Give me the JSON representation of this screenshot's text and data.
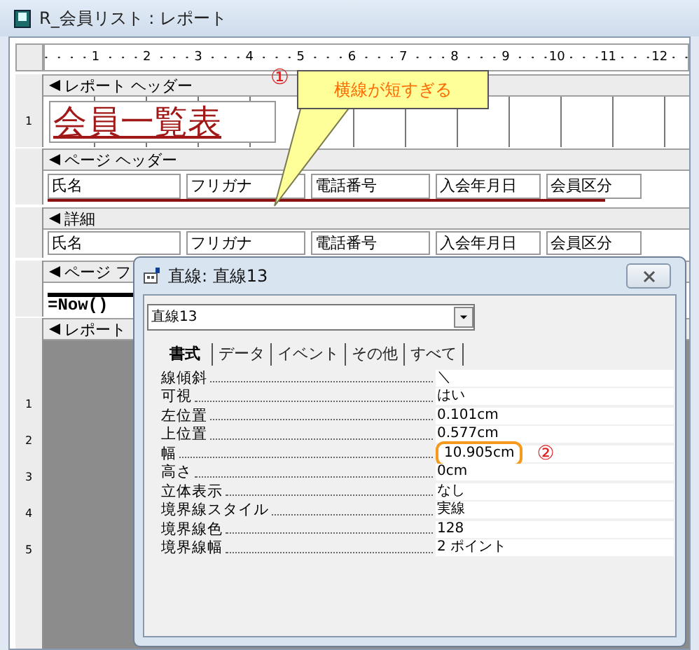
{
  "window": {
    "title": "R_会員リスト : レポート"
  },
  "ruler": {
    "labels": [
      "1",
      "2",
      "3",
      "4",
      "5",
      "6",
      "7",
      "8",
      "9",
      "10",
      "11",
      "12"
    ]
  },
  "left_ruler": {
    "header_label": "1",
    "bottom_labels": [
      "1",
      "2",
      "3",
      "4",
      "5"
    ]
  },
  "report_header": {
    "bar": "レポート ヘッダー",
    "title": "会員一覧表"
  },
  "page_header": {
    "bar": "ページ ヘッダー",
    "labels": [
      "氏名",
      "フリガナ",
      "電話番号",
      "入会年月日",
      "会員区分"
    ]
  },
  "detail": {
    "bar": "詳細",
    "fields": [
      "氏名",
      "フリガナ",
      "電話番号",
      "入会年月日",
      "会員区分"
    ]
  },
  "page_footer": {
    "bar": "ページ フ",
    "expression": "=Now()"
  },
  "report_footer": {
    "bar": "レポート"
  },
  "callout": {
    "marker": "①",
    "text": "横線が短すぎる"
  },
  "dialog": {
    "title": "直線: 直線13",
    "object": "直線13",
    "tabs": [
      {
        "label": "書式",
        "selected": true
      },
      {
        "label": "データ",
        "selected": false
      },
      {
        "label": "イベント",
        "selected": false
      },
      {
        "label": "その他",
        "selected": false
      },
      {
        "label": "すべて",
        "selected": false
      }
    ],
    "properties": [
      {
        "label": "線傾斜",
        "value": "＼",
        "highlighted": false
      },
      {
        "label": "可視",
        "value": "はい",
        "highlighted": false
      },
      {
        "label": "左位置",
        "value": "0.101cm",
        "highlighted": false
      },
      {
        "label": "上位置",
        "value": "0.577cm",
        "highlighted": false
      },
      {
        "label": "幅",
        "value": "10.905cm",
        "highlighted": true
      },
      {
        "label": "高さ",
        "value": "0cm",
        "highlighted": false
      },
      {
        "label": "立体表示",
        "value": "なし",
        "highlighted": false
      },
      {
        "label": "境界線スタイル",
        "value": "実線",
        "highlighted": false
      },
      {
        "label": "境界線色",
        "value": "128",
        "highlighted": false
      },
      {
        "label": "境界線幅",
        "value": "2 ポイント",
        "highlighted": false
      }
    ],
    "marker": "②"
  }
}
